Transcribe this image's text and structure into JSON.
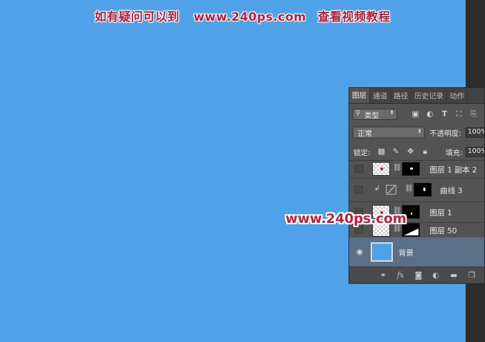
{
  "banner": {
    "part1": "如有疑问可以到",
    "part2": "www.240ps.com",
    "part3": "查看视频教程"
  },
  "panel": {
    "tabs": [
      {
        "label": "图层",
        "active": true
      },
      {
        "label": "通道",
        "active": false
      },
      {
        "label": "路径",
        "active": false
      },
      {
        "label": "历史记录",
        "active": false
      },
      {
        "label": "动作",
        "active": false
      }
    ],
    "filter": {
      "kind_label": "类型",
      "icons": [
        "image-filter-icon",
        "adjustment-filter-icon",
        "type-filter-icon",
        "shape-filter-icon",
        "smart-object-filter-icon"
      ]
    },
    "blend": {
      "mode": "正常",
      "opacity_label": "不透明度:",
      "opacity_value": "100%"
    },
    "lock": {
      "label": "锁定:",
      "icons": [
        "lock-transparent-icon",
        "lock-paint-icon",
        "lock-move-icon",
        "lock-all-icon"
      ],
      "fill_label": "填充:",
      "fill_value": "100%"
    },
    "layers": [
      {
        "name": "图层 1 副本 2",
        "visible": false,
        "selected": false
      },
      {
        "name": "曲线 3",
        "visible": false,
        "selected": false
      },
      {
        "name": "图层 1",
        "visible": false,
        "selected": false
      },
      {
        "name": "图层 50",
        "visible": false,
        "selected": false
      },
      {
        "name": "背景",
        "visible": true,
        "selected": true
      }
    ],
    "bottom_icons": [
      "link-layers-icon",
      "fx-icon",
      "add-mask-icon",
      "adjustment-layer-icon",
      "new-group-icon",
      "new-layer-icon"
    ]
  },
  "watermark": "www.240ps.com",
  "colors": {
    "canvas": "#4fa1e8",
    "panel": "#535353",
    "accent_red": "#c41e3a"
  }
}
